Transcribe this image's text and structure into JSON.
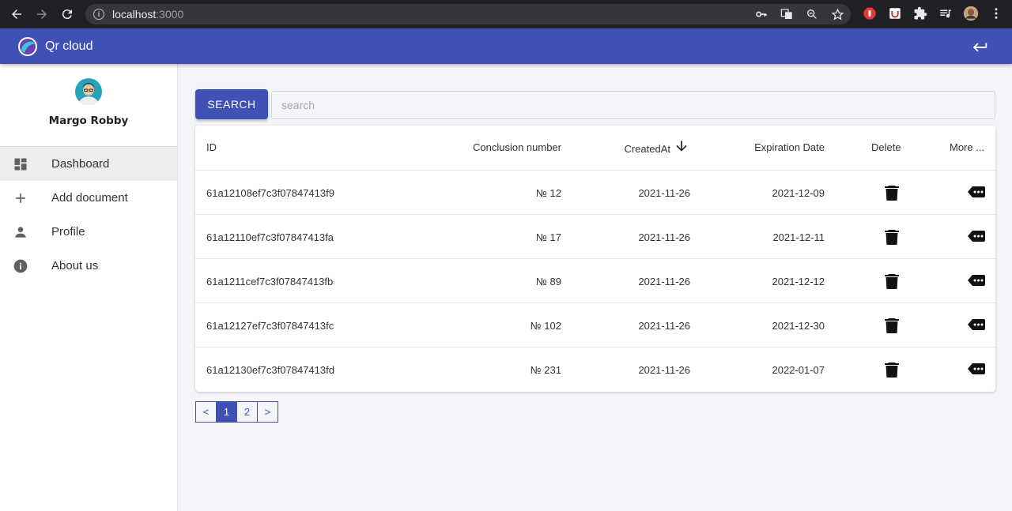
{
  "browser": {
    "url_host": "localhost",
    "url_port": ":3000"
  },
  "app": {
    "title": "Qr cloud",
    "accent": "#3f51b5"
  },
  "user": {
    "name": "Margo Robby"
  },
  "menu": [
    {
      "label": "Dashboard",
      "icon": "dashboard-icon",
      "active": true
    },
    {
      "label": "Add document",
      "icon": "plus-icon",
      "active": false
    },
    {
      "label": "Profile",
      "icon": "person-icon",
      "active": false
    },
    {
      "label": "About us",
      "icon": "info-icon",
      "active": false
    }
  ],
  "search": {
    "button_label": "SEARCH",
    "placeholder": "search",
    "value": ""
  },
  "table": {
    "headers": {
      "id": "ID",
      "number": "Conclusion number",
      "created": "CreatedAt",
      "expiration": "Expiration Date",
      "delete": "Delete",
      "more": "More ..."
    },
    "rows": [
      {
        "id": "61a12108ef7c3f07847413f9",
        "number": "№ 12",
        "created": "2021-11-26",
        "expiration": "2021-12-09"
      },
      {
        "id": "61a12110ef7c3f07847413fa",
        "number": "№ 17",
        "created": "2021-11-26",
        "expiration": "2021-12-11"
      },
      {
        "id": "61a1211cef7c3f07847413fb",
        "number": "№ 89",
        "created": "2021-11-26",
        "expiration": "2021-12-12"
      },
      {
        "id": "61a12127ef7c3f07847413fc",
        "number": "№ 102",
        "created": "2021-11-26",
        "expiration": "2021-12-30"
      },
      {
        "id": "61a12130ef7c3f07847413fd",
        "number": "№ 231",
        "created": "2021-11-26",
        "expiration": "2022-01-07"
      }
    ]
  },
  "pagination": {
    "prev": "<",
    "pages": [
      "1",
      "2"
    ],
    "current": "1",
    "next": ">"
  }
}
